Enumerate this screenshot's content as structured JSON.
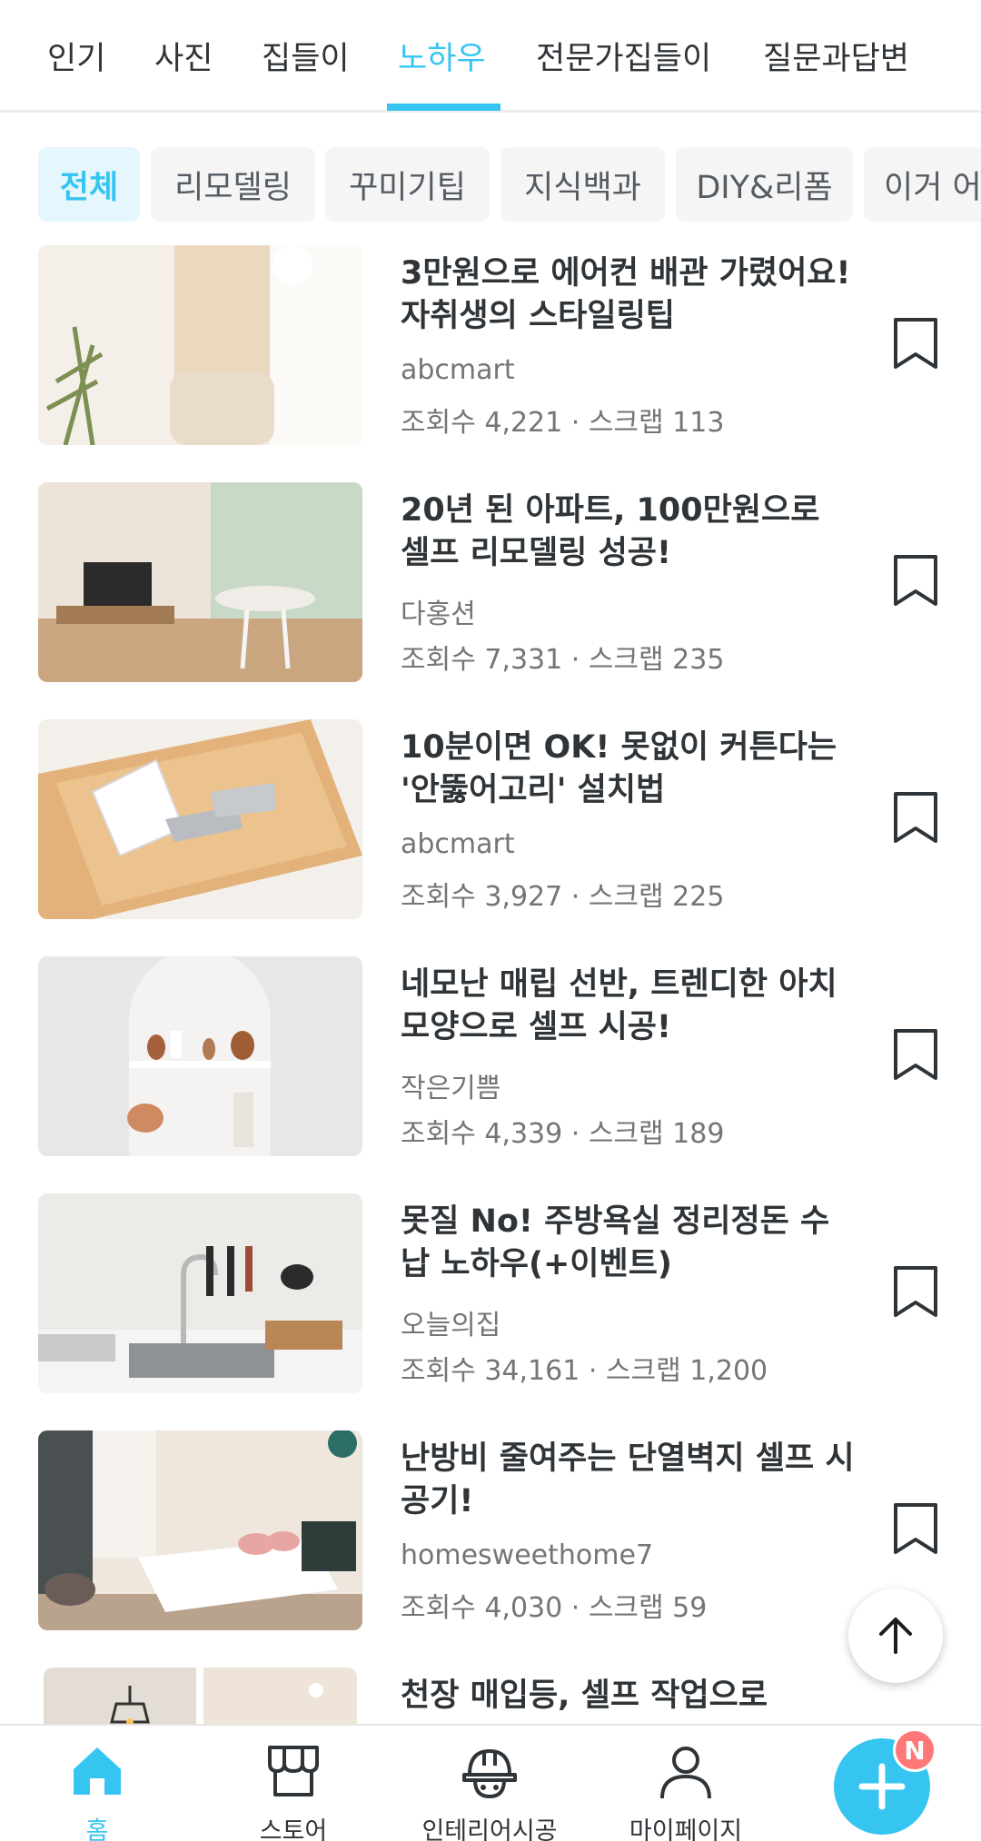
{
  "top_tabs": [
    "인기",
    "사진",
    "집들이",
    "노하우",
    "전문가집들이",
    "질문과답변"
  ],
  "active_top_tab": "노하우",
  "chips": [
    "전체",
    "리모델링",
    "꾸미기팁",
    "지식백과",
    "DIY&리폼",
    "이거 어"
  ],
  "active_chip": "전체",
  "articles": [
    {
      "title": "3만원으로 에어컨 배관 가렸어요! 자취생의 스타일링팁",
      "author": "abcmart",
      "stats": "조회수 4,221 · 스크랩 113"
    },
    {
      "title": "20년 된 아파트, 100만원으로 셀프 리모델링 성공!",
      "author": "다홍션",
      "stats": "조회수 7,331 · 스크랩 235"
    },
    {
      "title": "10분이면 OK! 못없이 커튼다는 '안뚫어고리' 설치법",
      "author": "abcmart",
      "stats": "조회수 3,927 · 스크랩 225"
    },
    {
      "title": "네모난 매립 선반, 트렌디한 아치 모양으로 셀프 시공!",
      "author": "작은기쁨",
      "stats": "조회수 4,339 · 스크랩 189"
    },
    {
      "title": "못질 No! 주방욕실 정리정돈 수납 노하우(+이벤트)",
      "author": "오늘의집",
      "stats": "조회수 34,161 · 스크랩 1,200"
    },
    {
      "title": "난방비 줄여주는 단열벽지 셀프 시공기!",
      "author": "homesweethome7",
      "stats": "조회수 4,030 · 스크랩 59"
    },
    {
      "title": "천장 매입등, 셀프 작업으로",
      "author": "",
      "stats": ""
    }
  ],
  "bottom_nav": [
    "홈",
    "스토어",
    "인테리어시공",
    "마이페이지"
  ],
  "fab_badge": "N",
  "colors": {
    "accent": "#35c5f0",
    "text": "#2f3438",
    "muted": "#757575",
    "badge": "#ff7777"
  },
  "icons": {
    "scroll_top": "arrow-up-icon",
    "bookmark": "bookmark-icon",
    "fab": "plus-icon"
  }
}
